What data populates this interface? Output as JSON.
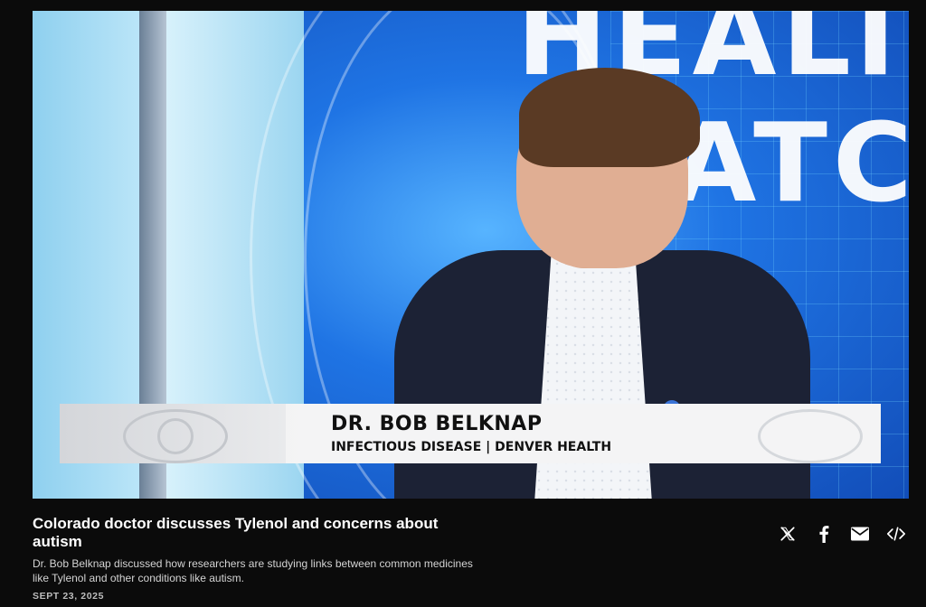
{
  "video": {
    "backdrop_line1": "HEALT",
    "backdrop_line2": "VATC",
    "lower_third": {
      "name": "DR. BOB BELKNAP",
      "title": "INFECTIOUS DISEASE | DENVER HEALTH"
    }
  },
  "article": {
    "headline": "Colorado doctor discusses Tylenol and concerns about autism",
    "description": "Dr. Bob Belknap discussed how researchers are studying links between common medicines like Tylenol and other conditions like autism.",
    "date": "SEPT 23, 2025"
  },
  "share": {
    "icons": [
      "x-icon",
      "facebook-icon",
      "email-icon",
      "embed-icon"
    ]
  },
  "colors": {
    "page_bg": "#0b0b0b",
    "backdrop_blue": "#1f74e4",
    "lower_third_bg": "#f4f4f5",
    "text_primary": "#ffffff"
  }
}
